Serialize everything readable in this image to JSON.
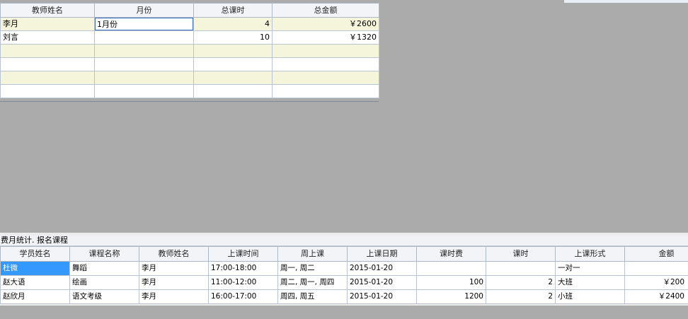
{
  "teacher_table": {
    "headers": [
      "教师姓名",
      "月份",
      "总课时",
      "总金额"
    ],
    "rows": [
      {
        "teacher": "李月",
        "month": "1月份",
        "hours": "4",
        "amount": "￥2600"
      },
      {
        "teacher": "刘言",
        "month": "",
        "hours": "10",
        "amount": "￥1320"
      },
      {
        "teacher": "",
        "month": "",
        "hours": "",
        "amount": ""
      },
      {
        "teacher": "",
        "month": "",
        "hours": "",
        "amount": ""
      },
      {
        "teacher": "",
        "month": "",
        "hours": "",
        "amount": ""
      },
      {
        "teacher": "",
        "month": "",
        "hours": "",
        "amount": ""
      }
    ]
  },
  "panel": {
    "title": "费月统计. 报名课程"
  },
  "enroll_table": {
    "headers": [
      "学员姓名",
      "课程名称",
      "教师姓名",
      "上课时间",
      "周上课",
      "上课日期",
      "课时费",
      "课时",
      "上课形式",
      "金额"
    ],
    "rows": [
      {
        "student": "杜微",
        "course": "舞蹈",
        "teacher": "李月",
        "time": "17:00-18:00",
        "weekdays": "周一, 周二",
        "date": "2015-01-20",
        "fee": "",
        "hours": "",
        "form": "一对一",
        "amount": ""
      },
      {
        "student": "赵大语",
        "course": "绘画",
        "teacher": "李月",
        "time": "11:00-12:00",
        "weekdays": "周二, 周一, 周四",
        "date": "2015-01-20",
        "fee": "100",
        "hours": "2",
        "form": "大班",
        "amount": "￥200"
      },
      {
        "student": "赵欣月",
        "course": "语文考级",
        "teacher": "李月",
        "time": "16:00-17:00",
        "weekdays": "周四, 周五",
        "date": "2015-01-20",
        "fee": "1200",
        "hours": "2",
        "form": "小班",
        "amount": "￥2400"
      }
    ]
  }
}
